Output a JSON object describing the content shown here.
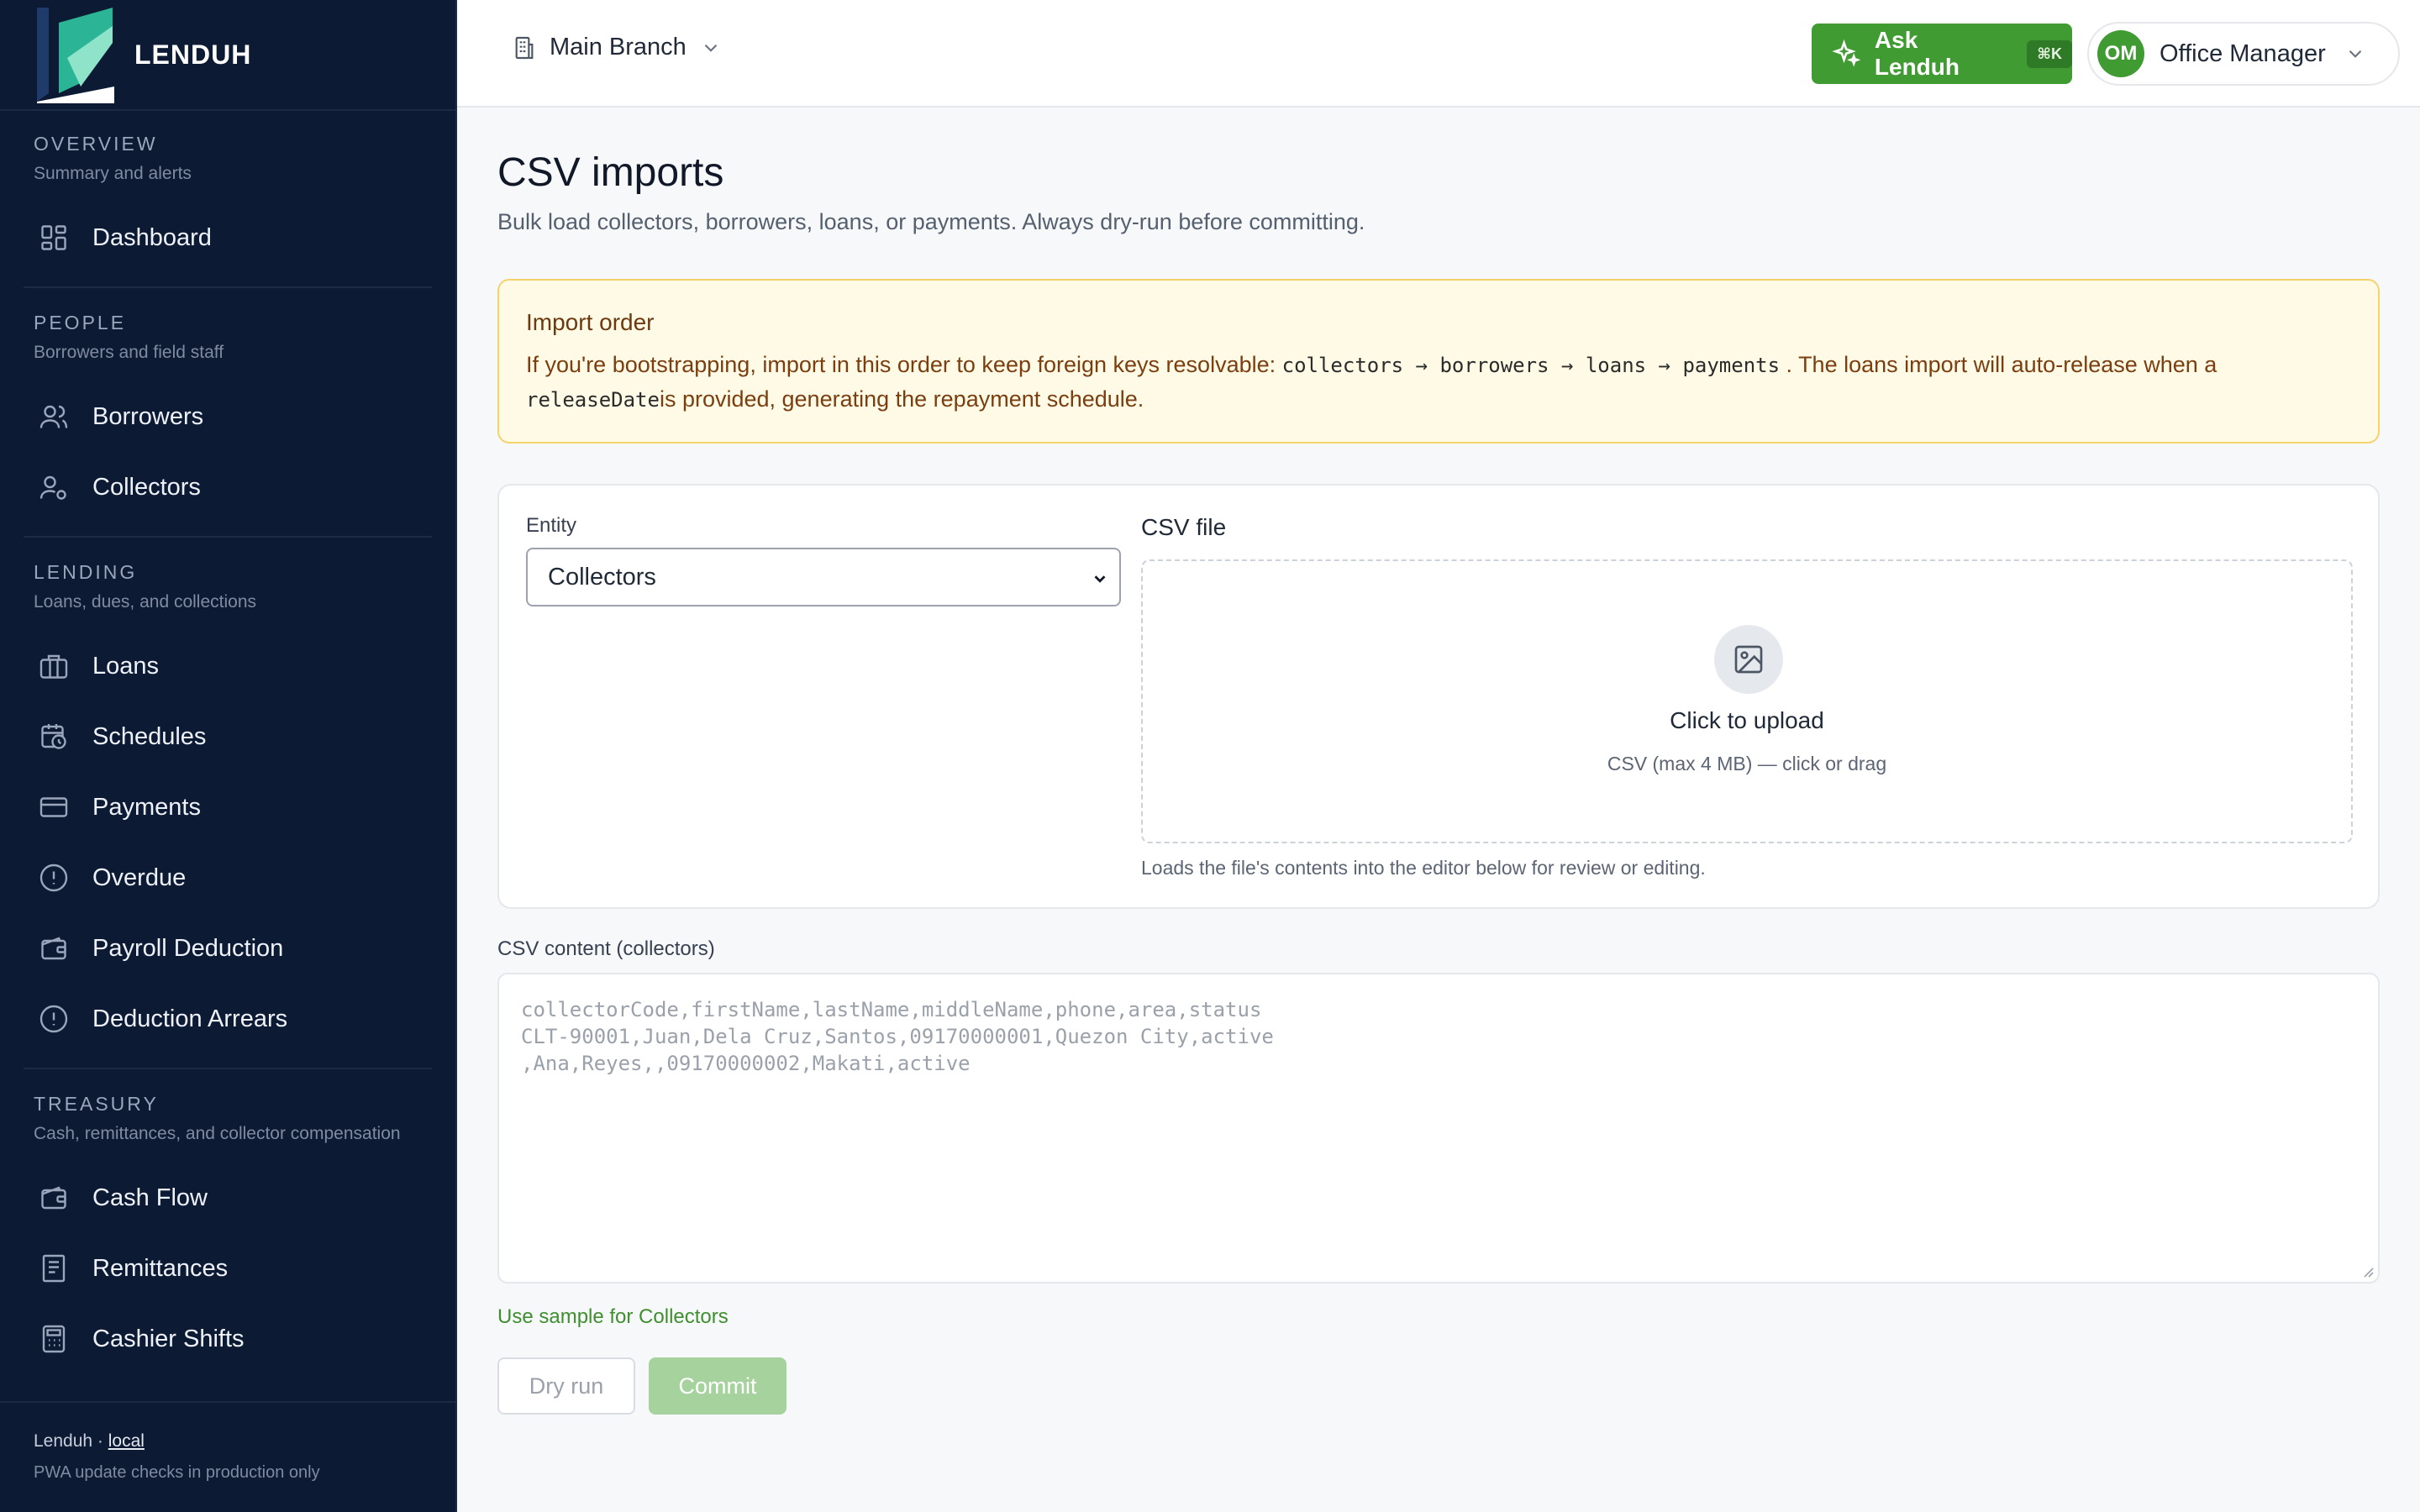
{
  "brand": {
    "name": "LENDUH"
  },
  "sidebar": {
    "sections": [
      {
        "title": "OVERVIEW",
        "subtitle": "Summary and alerts",
        "items": [
          {
            "label": "Dashboard",
            "icon": "dashboard-icon"
          }
        ]
      },
      {
        "title": "PEOPLE",
        "subtitle": "Borrowers and field staff",
        "items": [
          {
            "label": "Borrowers",
            "icon": "users-icon"
          },
          {
            "label": "Collectors",
            "icon": "user-gear-icon"
          }
        ]
      },
      {
        "title": "LENDING",
        "subtitle": "Loans, dues, and collections",
        "items": [
          {
            "label": "Loans",
            "icon": "briefcase-icon"
          },
          {
            "label": "Schedules",
            "icon": "calendar-clock-icon"
          },
          {
            "label": "Payments",
            "icon": "card-icon"
          },
          {
            "label": "Overdue",
            "icon": "alert-circle-icon"
          },
          {
            "label": "Payroll Deduction",
            "icon": "wallet-icon"
          },
          {
            "label": "Deduction Arrears",
            "icon": "alert-circle-icon"
          }
        ]
      },
      {
        "title": "TREASURY",
        "subtitle": "Cash, remittances, and collector compensation",
        "items": [
          {
            "label": "Cash Flow",
            "icon": "wallet-icon"
          },
          {
            "label": "Remittances",
            "icon": "receipt-icon"
          },
          {
            "label": "Cashier Shifts",
            "icon": "calculator-icon"
          }
        ]
      }
    ],
    "footer": {
      "app": "Lenduh",
      "env": "local",
      "note": "PWA update checks in production only"
    }
  },
  "topbar": {
    "branch": "Main Branch",
    "ask_label": "Ask Lenduh",
    "ask_shortcut": "⌘K",
    "user_initials": "OM",
    "user_name": "Office Manager"
  },
  "page": {
    "title": "CSV imports",
    "subtitle": "Bulk load collectors, borrowers, loans, or payments. Always dry-run before committing."
  },
  "alert": {
    "title": "Import order",
    "text1": "If you're bootstrapping, import in this order to keep foreign keys resolvable: ",
    "order": "collectors → borrowers → loans → payments",
    "text2": " . The loans import will auto-release when a",
    "field": "releaseDate",
    "text3": "is provided, generating the repayment schedule."
  },
  "form": {
    "entity_label": "Entity",
    "entity_value": "Collectors",
    "csv_label": "CSV file",
    "upload_title": "Click to upload",
    "upload_sub": "CSV (max 4 MB) — click or drag",
    "upload_help": "Loads the file's contents into the editor below for review or editing.",
    "content_label": "CSV content (collectors)",
    "content_placeholder": "collectorCode,firstName,lastName,middleName,phone,area,status\nCLT-90001,Juan,Dela Cruz,Santos,09170000001,Quezon City,active\n,Ana,Reyes,,09170000002,Makati,active",
    "sample_link": "Use sample for Collectors",
    "dry_run": "Dry run",
    "commit": "Commit"
  }
}
